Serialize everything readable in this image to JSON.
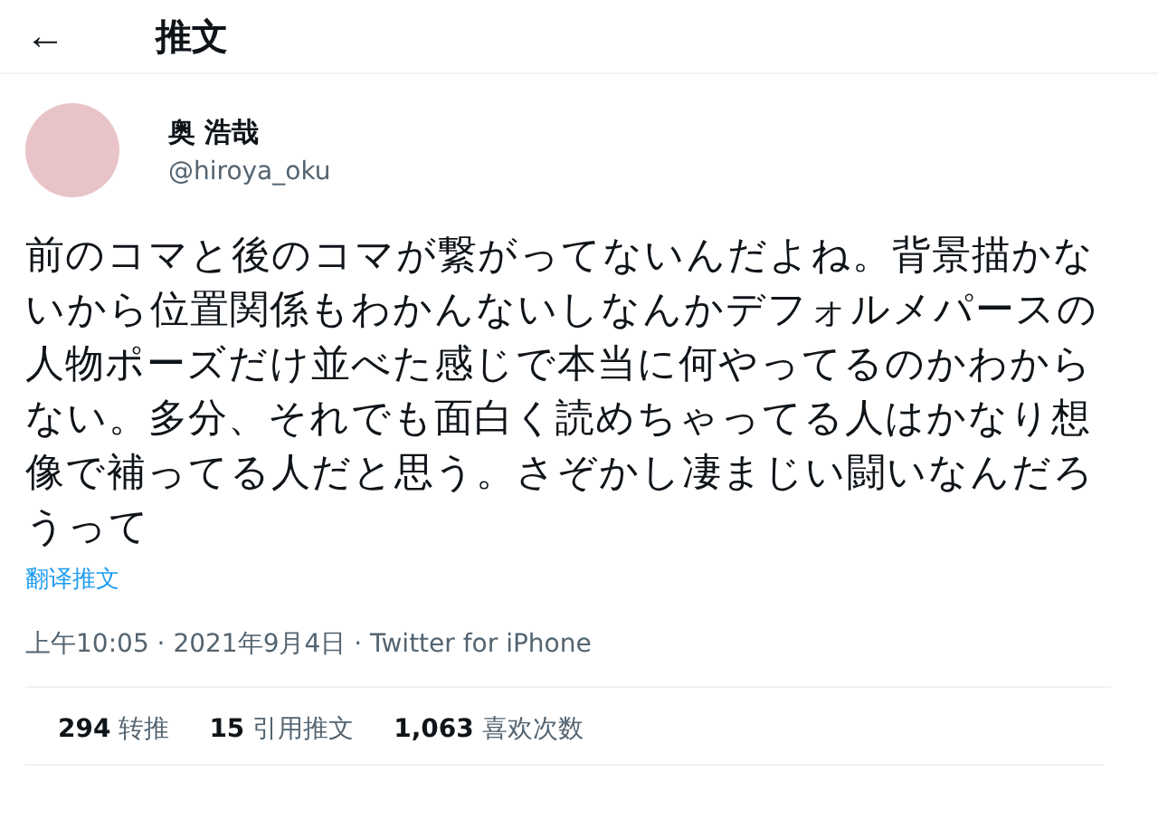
{
  "header": {
    "back": "←",
    "title": "推文"
  },
  "author": {
    "name": "奥 浩哉",
    "handle": "@hiroya_oku"
  },
  "tweet": {
    "text": "前のコマと後のコマが繋がってないんだよね。背景描かないから位置関係もわかんないしなんかデフォルメパースの人物ポーズだけ並べた感じで本当に何やってるのかわからない。多分、それでも面白く読めちゃってる人はかなり想像で補ってる人だと思う。さぞかし凄まじい闘いなんだろうって",
    "translate": "翻译推文",
    "meta": "上午10:05 · 2021年9月4日 · Twitter for iPhone"
  },
  "stats": [
    {
      "count": "294",
      "label": "转推"
    },
    {
      "count": "15",
      "label": "引用推文"
    },
    {
      "count": "1,063",
      "label": "喜欢次数"
    }
  ]
}
